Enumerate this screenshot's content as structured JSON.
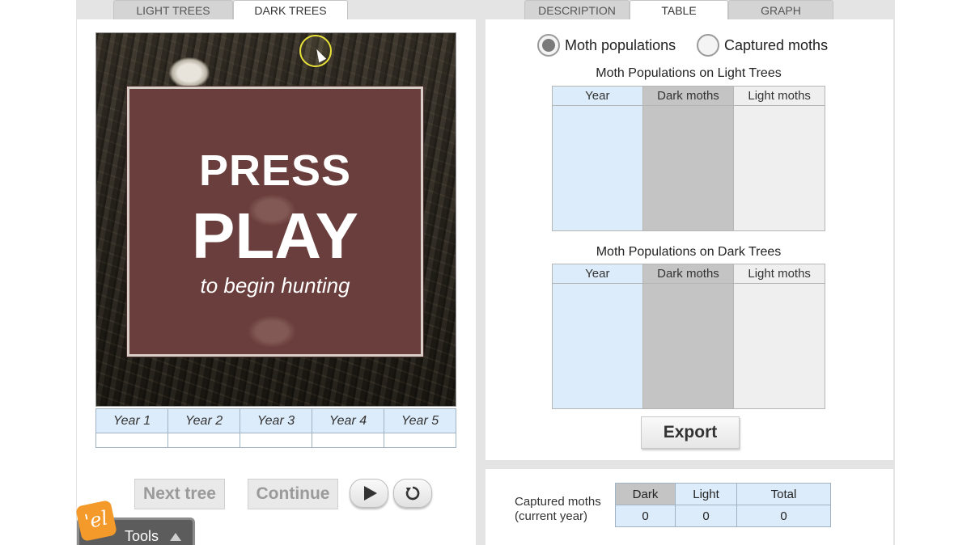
{
  "left_tabs": [
    {
      "label": "LIGHT TREES",
      "active": false
    },
    {
      "label": "DARK TREES",
      "active": true
    }
  ],
  "right_tabs": [
    {
      "label": "DESCRIPTION",
      "active": false
    },
    {
      "label": "TABLE",
      "active": true
    },
    {
      "label": "GRAPH",
      "active": false
    }
  ],
  "scene": {
    "line1": "PRESS",
    "line2": "PLAY",
    "line3": "to begin hunting"
  },
  "years": [
    "Year 1",
    "Year 2",
    "Year 3",
    "Year 4",
    "Year 5"
  ],
  "controls": {
    "next_tree": "Next tree",
    "continue": "Continue",
    "play_icon": "play-icon",
    "reset_icon": "reset-icon"
  },
  "tools": {
    "label": "Tools",
    "logo": "'el"
  },
  "radio": {
    "option1": "Moth populations",
    "option2": "Captured moths",
    "selected": "Moth populations"
  },
  "light_table": {
    "title": "Moth Populations on Light Trees",
    "headers": [
      "Year",
      "Dark moths",
      "Light moths"
    ]
  },
  "dark_table": {
    "title": "Moth Populations on Dark Trees",
    "headers": [
      "Year",
      "Dark moths",
      "Light moths"
    ]
  },
  "export_label": "Export",
  "captured": {
    "label_line1": "Captured moths",
    "label_line2": "(current year)",
    "headers": [
      "Dark",
      "Light",
      "Total"
    ],
    "values": [
      "0",
      "0",
      "0"
    ]
  },
  "colors": {
    "year_column": "#dcecfa",
    "dark_column": "#c4c4c4",
    "light_column": "#efefef",
    "press_box": "#6a3e3c"
  }
}
